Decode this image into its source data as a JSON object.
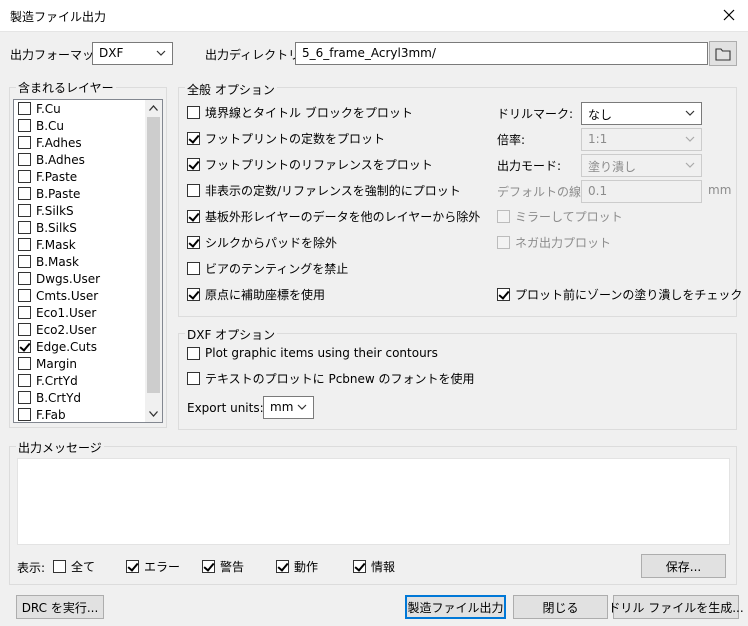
{
  "window": {
    "title": "製造ファイル出力"
  },
  "top": {
    "format_label": "出力フォーマット:",
    "format_value": "DXF",
    "dir_label": "出力ディレクトリー:",
    "dir_value": "5_6_frame_Acryl3mm/"
  },
  "layers": {
    "title": "含まれるレイヤー",
    "items": [
      {
        "label": "F.Cu",
        "checked": false
      },
      {
        "label": "B.Cu",
        "checked": false
      },
      {
        "label": "F.Adhes",
        "checked": false
      },
      {
        "label": "B.Adhes",
        "checked": false
      },
      {
        "label": "F.Paste",
        "checked": false
      },
      {
        "label": "B.Paste",
        "checked": false
      },
      {
        "label": "F.SilkS",
        "checked": false
      },
      {
        "label": "B.SilkS",
        "checked": false
      },
      {
        "label": "F.Mask",
        "checked": false
      },
      {
        "label": "B.Mask",
        "checked": false
      },
      {
        "label": "Dwgs.User",
        "checked": false
      },
      {
        "label": "Cmts.User",
        "checked": false
      },
      {
        "label": "Eco1.User",
        "checked": false
      },
      {
        "label": "Eco2.User",
        "checked": false
      },
      {
        "label": "Edge.Cuts",
        "checked": true
      },
      {
        "label": "Margin",
        "checked": false
      },
      {
        "label": "F.CrtYd",
        "checked": false
      },
      {
        "label": "B.CrtYd",
        "checked": false
      },
      {
        "label": "F.Fab",
        "checked": false
      }
    ]
  },
  "general": {
    "title": "全般 オプション",
    "options": [
      {
        "label": "境界線とタイトル ブロックをプロット",
        "checked": false
      },
      {
        "label": "フットプリントの定数をプロット",
        "checked": true
      },
      {
        "label": "フットプリントのリファレンスをプロット",
        "checked": true
      },
      {
        "label": "非表示の定数/リファレンスを強制的にプロット",
        "checked": false
      },
      {
        "label": "基板外形レイヤーのデータを他のレイヤーから除外",
        "checked": true
      },
      {
        "label": "シルクからパッドを除外",
        "checked": true
      },
      {
        "label": "ビアのテンティングを禁止",
        "checked": false
      },
      {
        "label": "原点に補助座標を使用",
        "checked": true
      }
    ],
    "drill_mark_label": "ドリルマーク:",
    "drill_mark_value": "なし",
    "scale_label": "倍率:",
    "scale_value": "1:1",
    "output_mode_label": "出力モード:",
    "output_mode_value": "塗り潰し",
    "default_width_label": "デフォルトの線幅:",
    "default_width_value": "0.1",
    "default_width_unit": "mm",
    "mirror_label": "ミラーしてプロット",
    "negative_label": "ネガ出力プロット",
    "zone_check_label": "プロット前にゾーンの塗り潰しをチェック"
  },
  "dxf": {
    "title": "DXF オプション",
    "contours_label": "Plot graphic items using their contours",
    "pcbnew_font_label": "テキストのプロットに Pcbnew のフォントを使用",
    "units_label": "Export units:",
    "units_value": "mm"
  },
  "messages": {
    "title": "出力メッセージ",
    "show_label": "表示:",
    "filters": [
      {
        "label": "全て",
        "checked": false
      },
      {
        "label": "エラー",
        "checked": true
      },
      {
        "label": "警告",
        "checked": true
      },
      {
        "label": "動作",
        "checked": true
      },
      {
        "label": "情報",
        "checked": true
      }
    ],
    "save_label": "保存..."
  },
  "buttons": {
    "drc": "DRC を実行...",
    "plot": "製造ファイル出力",
    "close": "閉じる",
    "drill": "ドリル ファイルを生成..."
  }
}
